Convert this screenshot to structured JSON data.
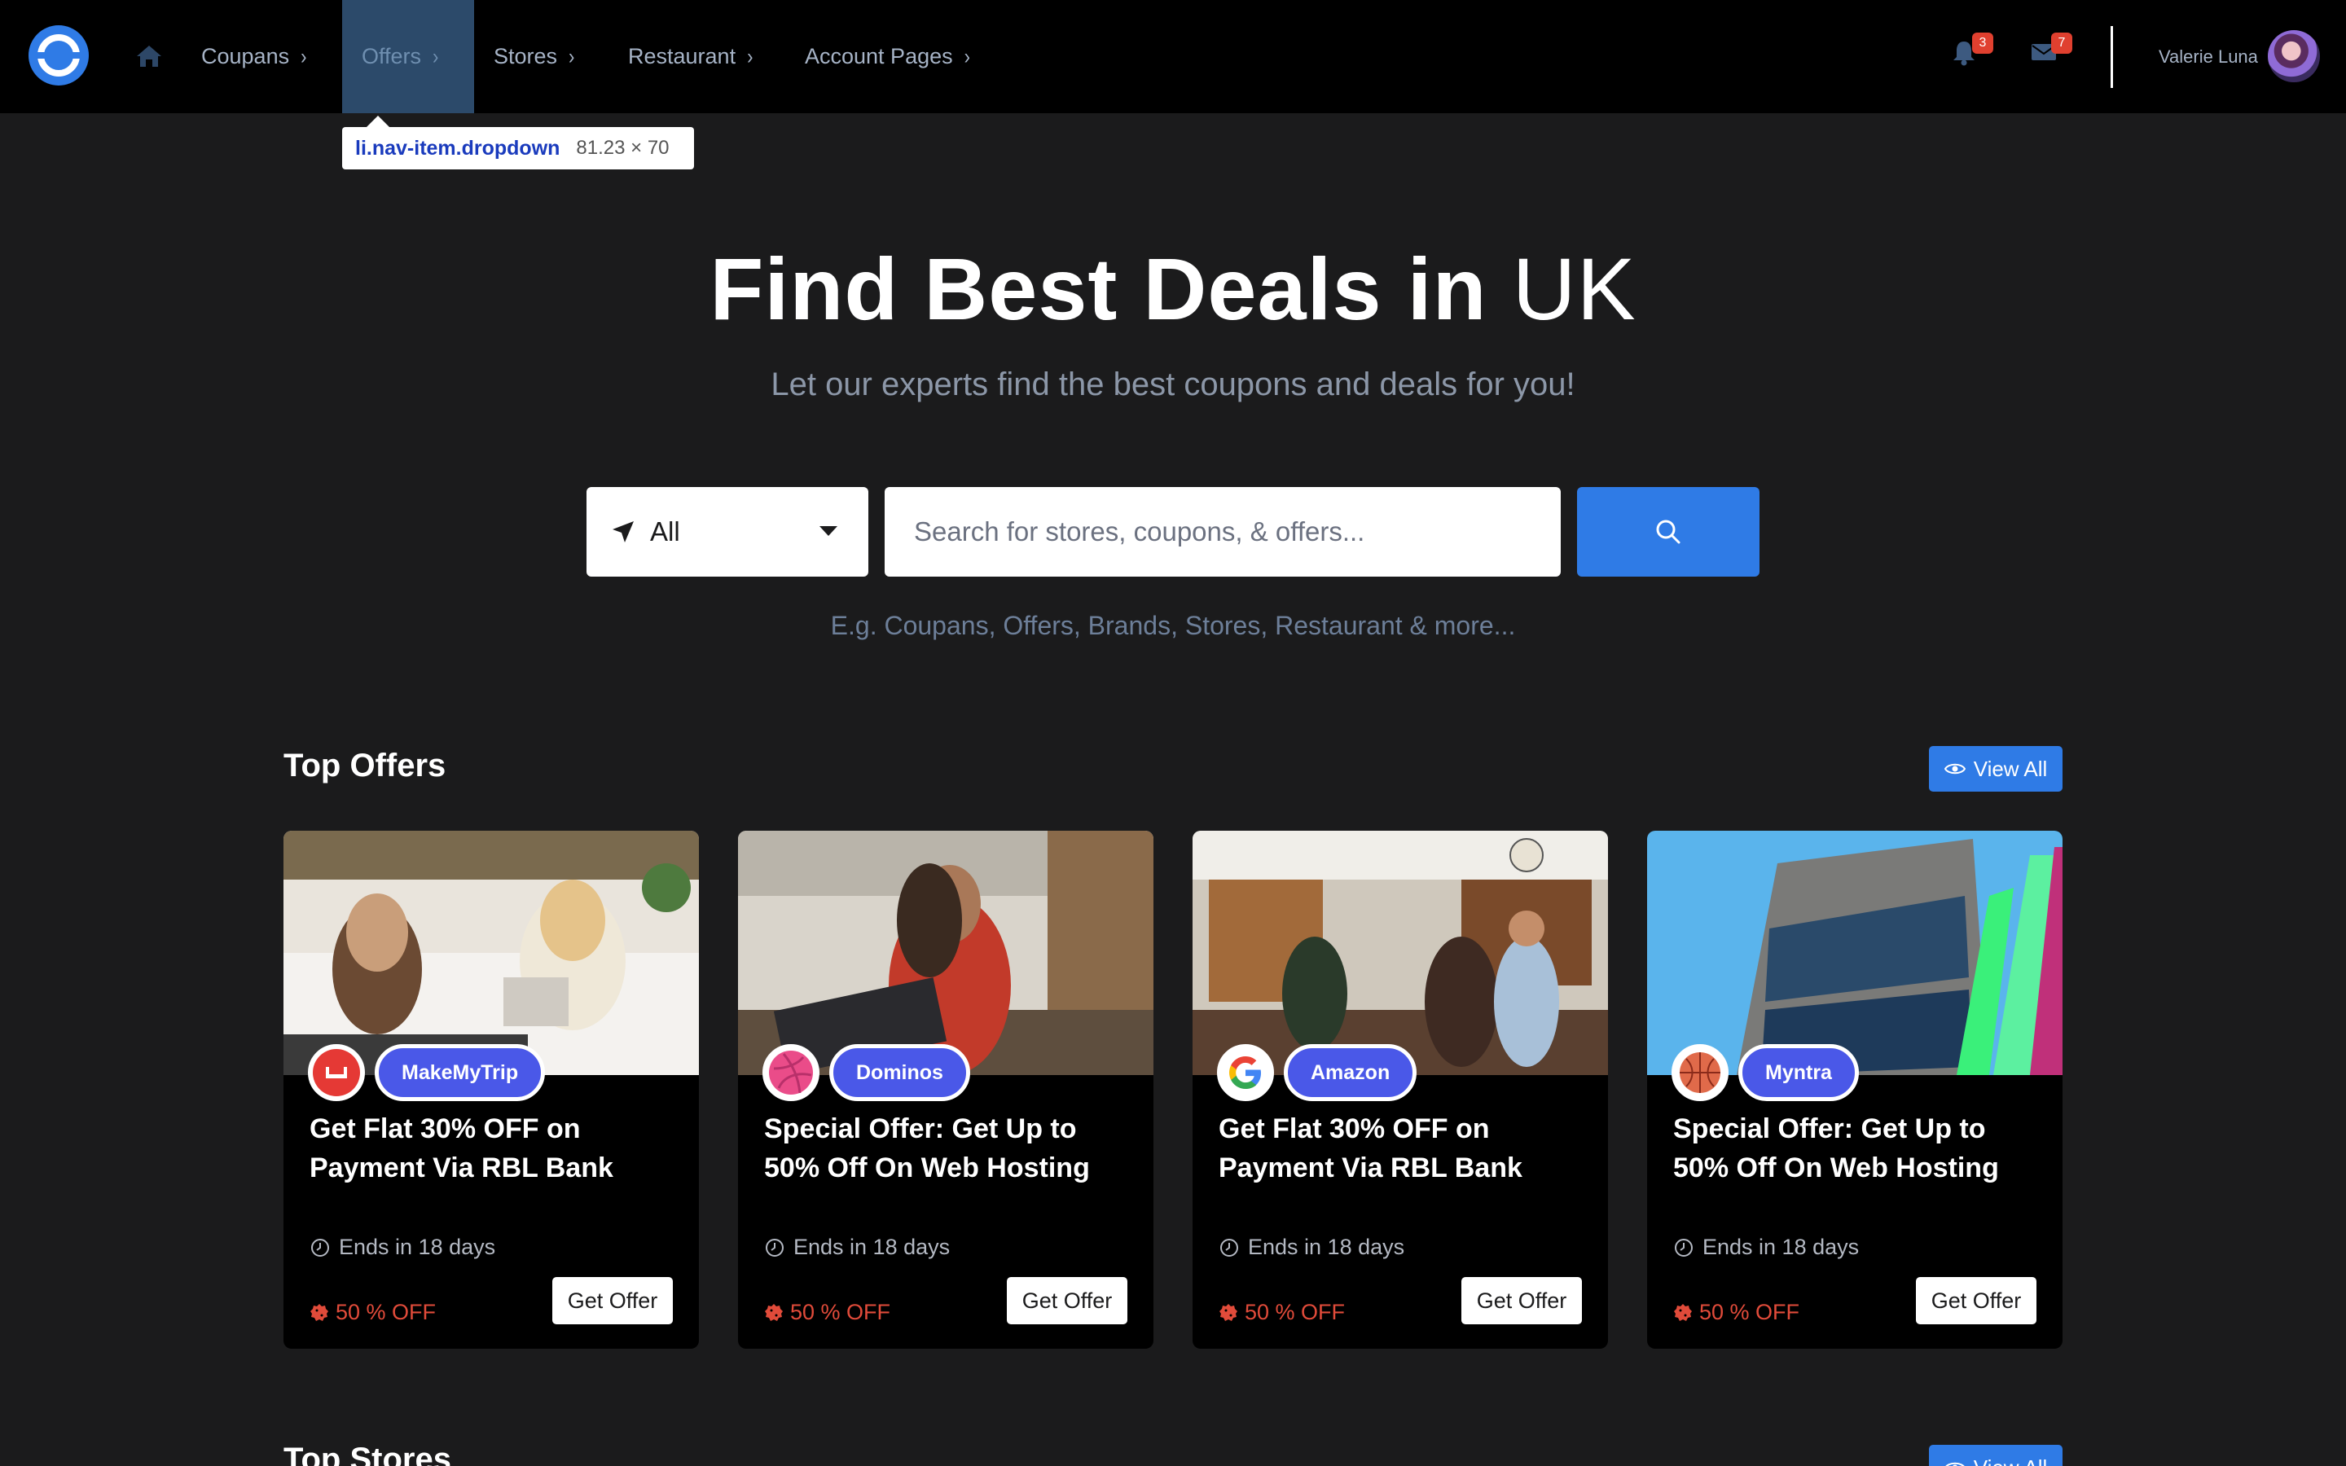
{
  "nav": {
    "items": [
      {
        "label": "Coupans"
      },
      {
        "label": "Offers"
      },
      {
        "label": "Stores"
      },
      {
        "label": "Restaurant"
      },
      {
        "label": "Account Pages"
      }
    ],
    "active_item": "Offers",
    "notifications_count": "3",
    "messages_count": "7",
    "user_name": "Valerie Luna"
  },
  "devtools_tooltip": {
    "tag": "li",
    "classes": ".nav-item.dropdown",
    "dimensions": "81.23 × 70"
  },
  "hero": {
    "title_bold": "Find Best Deals in",
    "title_light": "UK",
    "subtitle": "Let our experts find the best coupons and deals for you!",
    "location_selected": "All",
    "search_placeholder": "Search for stores, coupons, & offers...",
    "hint": "E.g. Coupans, Offers, Brands, Stores, Restaurant & more..."
  },
  "top_offers": {
    "title": "Top Offers",
    "view_all_label": "View All",
    "offers": [
      {
        "store": "MakeMyTrip",
        "title": "Get Flat 30% OFF on Payment Via RBL Bank",
        "ends": "Ends in 18 days",
        "discount": "50 % OFF",
        "cta": "Get Offer",
        "logo_icon": "couch-logo-icon"
      },
      {
        "store": "Dominos",
        "title": "Special Offer: Get Up to 50% Off On Web Hosting",
        "ends": "Ends in 18 days",
        "discount": "50 % OFF",
        "cta": "Get Offer",
        "logo_icon": "dribbble-logo-icon"
      },
      {
        "store": "Amazon",
        "title": "Get Flat 30% OFF on Payment Via RBL Bank",
        "ends": "Ends in 18 days",
        "discount": "50 % OFF",
        "cta": "Get Offer",
        "logo_icon": "google-logo-icon"
      },
      {
        "store": "Myntra",
        "title": "Special Offer: Get Up to 50% Off On Web Hosting",
        "ends": "Ends in 18 days",
        "discount": "50 % OFF",
        "cta": "Get Offer",
        "logo_icon": "basketball-logo-icon"
      }
    ]
  },
  "top_stores": {
    "title": "Top Stores",
    "view_all_label": "View All"
  },
  "colors": {
    "accent": "#2f7be6",
    "background": "#1b1b1c",
    "navbar": "#000000",
    "pill": "#4a58e8",
    "discount": "#e14b3a",
    "badge": "#e0402f"
  }
}
